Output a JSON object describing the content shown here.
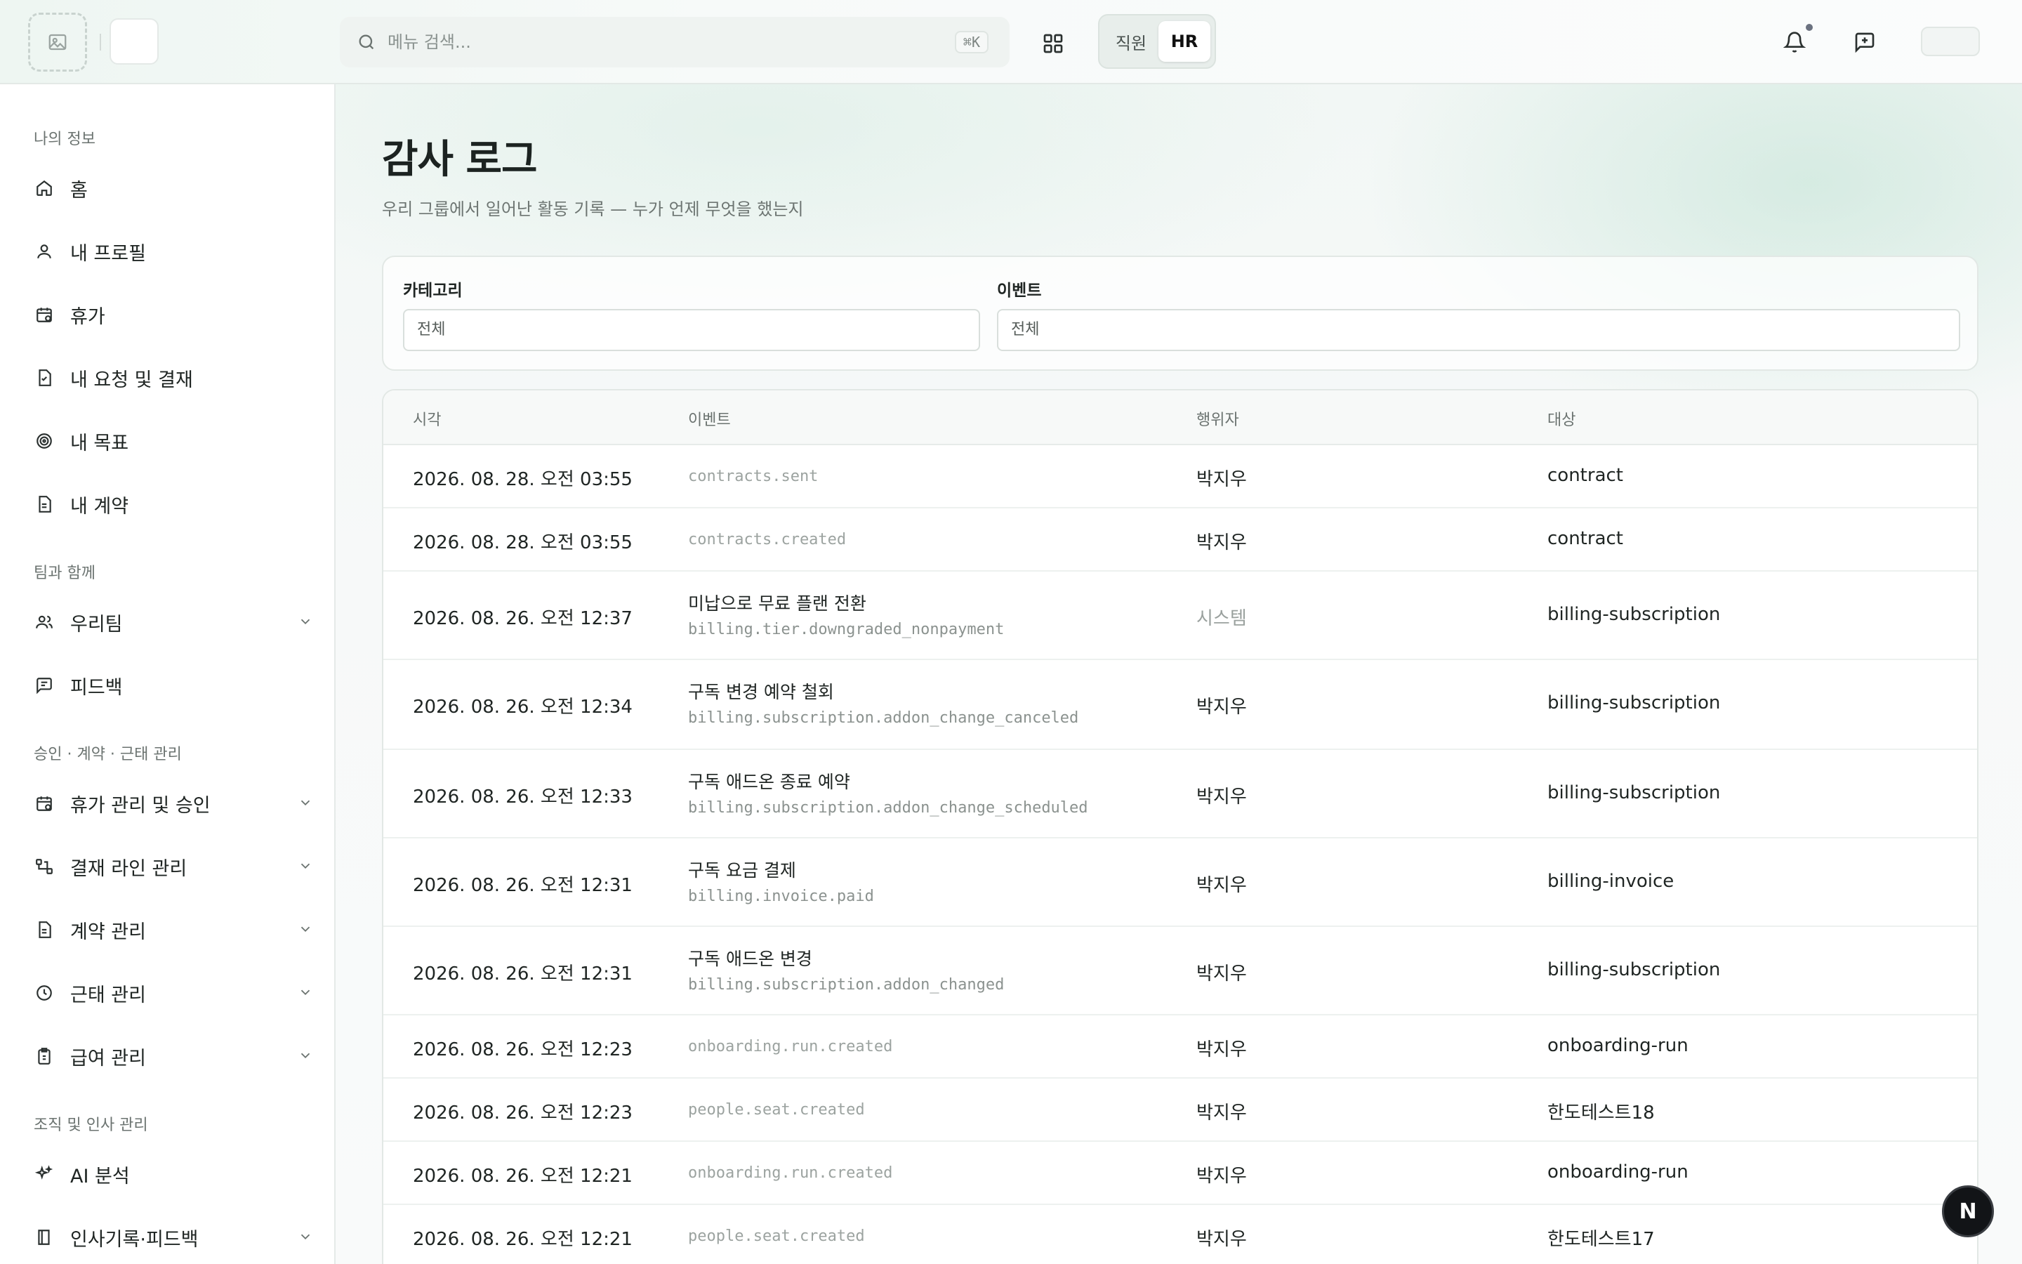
{
  "header": {
    "search_placeholder": "메뉴 검색...",
    "search_shortcut": "⌘K",
    "role_employee": "직원",
    "role_hr": "HR"
  },
  "sidebar": {
    "sections": [
      {
        "title": "나의 정보"
      },
      {
        "title": "팀과 함께"
      },
      {
        "title": "승인 · 계약 · 근태 관리"
      },
      {
        "title": "조직 및 인사 관리"
      }
    ],
    "items": [
      {
        "label": "홈",
        "icon": "home-icon"
      },
      {
        "label": "내 프로필",
        "icon": "user-icon"
      },
      {
        "label": "휴가",
        "icon": "calendar-icon"
      },
      {
        "label": "내 요청 및 결재",
        "icon": "document-check-icon"
      },
      {
        "label": "내 목표",
        "icon": "target-icon"
      },
      {
        "label": "내 계약",
        "icon": "file-icon"
      },
      {
        "label": "우리팀",
        "icon": "users-icon"
      },
      {
        "label": "피드백",
        "icon": "message-icon"
      },
      {
        "label": "휴가 관리 및 승인",
        "icon": "calendar-clock-icon"
      },
      {
        "label": "결재 라인 관리",
        "icon": "flow-icon"
      },
      {
        "label": "계약 관리",
        "icon": "file-icon"
      },
      {
        "label": "근태 관리",
        "icon": "clock-icon"
      },
      {
        "label": "급여 관리",
        "icon": "clipboard-money-icon"
      },
      {
        "label": "AI 분석",
        "icon": "sparkles-icon"
      },
      {
        "label": "인사기록·피드백",
        "icon": "book-icon"
      }
    ]
  },
  "page": {
    "title": "감사 로그",
    "subtitle": "우리 그룹에서 일어난 활동 기록 — 누가 언제 무엇을 했는지"
  },
  "filters": {
    "category_label": "카테고리",
    "category_value": "전체",
    "event_label": "이벤트",
    "event_value": "전체"
  },
  "table": {
    "columns": [
      "시각",
      "이벤트",
      "행위자",
      "대상"
    ],
    "rows": [
      {
        "time": "2026. 08. 28. 오전 03:55",
        "title": "",
        "code": "contracts.sent",
        "actor": "박지우",
        "target": "contract"
      },
      {
        "time": "2026. 08. 28. 오전 03:55",
        "title": "",
        "code": "contracts.created",
        "actor": "박지우",
        "target": "contract"
      },
      {
        "time": "2026. 08. 26. 오전 12:37",
        "title": "미납으로 무료 플랜 전환",
        "code": "billing.tier.downgraded_nonpayment",
        "actor": "시스템",
        "target": "billing-subscription"
      },
      {
        "time": "2026. 08. 26. 오전 12:34",
        "title": "구독 변경 예약 철회",
        "code": "billing.subscription.addon_change_canceled",
        "actor": "박지우",
        "target": "billing-subscription"
      },
      {
        "time": "2026. 08. 26. 오전 12:33",
        "title": "구독 애드온 종료 예약",
        "code": "billing.subscription.addon_change_scheduled",
        "actor": "박지우",
        "target": "billing-subscription"
      },
      {
        "time": "2026. 08. 26. 오전 12:31",
        "title": "구독 요금 결제",
        "code": "billing.invoice.paid",
        "actor": "박지우",
        "target": "billing-invoice"
      },
      {
        "time": "2026. 08. 26. 오전 12:31",
        "title": "구독 애드온 변경",
        "code": "billing.subscription.addon_changed",
        "actor": "박지우",
        "target": "billing-subscription"
      },
      {
        "time": "2026. 08. 26. 오전 12:23",
        "title": "",
        "code": "onboarding.run.created",
        "actor": "박지우",
        "target": "onboarding-run"
      },
      {
        "time": "2026. 08. 26. 오전 12:23",
        "title": "",
        "code": "people.seat.created",
        "actor": "박지우",
        "target": "한도테스트18"
      },
      {
        "time": "2026. 08. 26. 오전 12:21",
        "title": "",
        "code": "onboarding.run.created",
        "actor": "박지우",
        "target": "onboarding-run"
      },
      {
        "time": "2026. 08. 26. 오전 12:21",
        "title": "",
        "code": "people.seat.created",
        "actor": "박지우",
        "target": "한도테스트17"
      }
    ]
  },
  "floating_badge": "N"
}
